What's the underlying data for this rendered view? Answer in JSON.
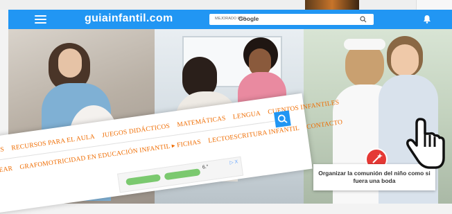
{
  "header": {
    "brand": "guiainfantil.com",
    "search_label": "MEJORADO POR",
    "search_provider": "Google",
    "color": "#2196f3"
  },
  "nav": {
    "row1": [
      "ES",
      "RECURSOS PARA EL AULA",
      "JUEGOS DIDÁCTICOS",
      "MATEMÁTICAS",
      "LENGUA",
      "CUENTOS INFANTILES"
    ],
    "row2": [
      "EAR",
      "GRAFOMOTRICIDAD EN EDUCACIÓN INFANTIL ▸ FICHAS",
      "LECTOESCRITURA INFANTIL",
      "CONTACTO"
    ]
  },
  "ad": {
    "text": "6.°",
    "ad_mark": "▷ X"
  },
  "feature": {
    "caption": "Organizar la comunión del niño como si fuera una boda",
    "badge_icon": "magic-wand-icon"
  },
  "icons": {
    "menu": "hamburger-menu-icon",
    "search": "search-icon",
    "notifications": "bell-icon",
    "cursor": "hand-pointer-icon"
  },
  "colors": {
    "accent": "#2196f3",
    "nav_text": "#ef6c00",
    "badge": "#e53935"
  }
}
